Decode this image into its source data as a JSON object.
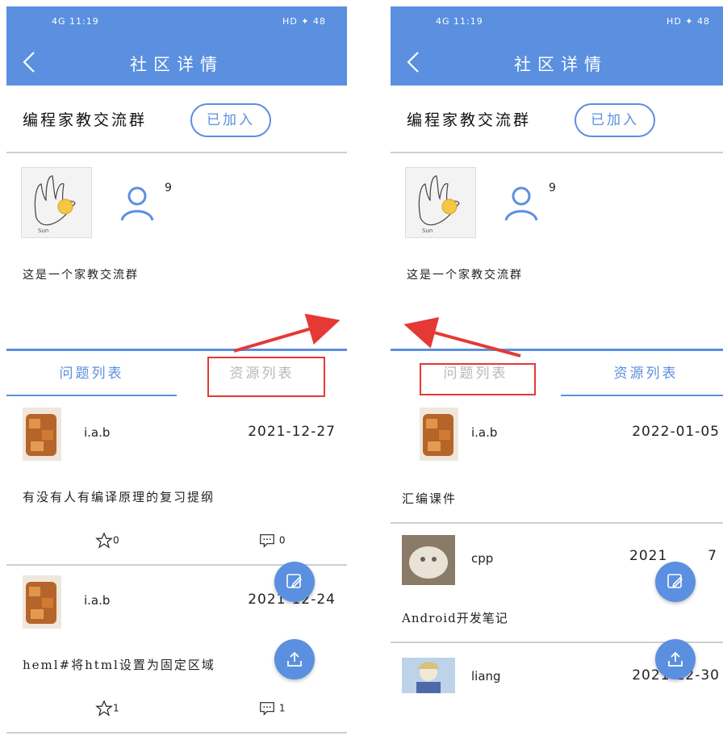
{
  "left": {
    "status": {
      "left": "4G 11:19",
      "right": "HD ✦ 48"
    },
    "nav": {
      "title": "社区详情"
    },
    "group": {
      "name": "编程家教交流群",
      "join_label": "已加入"
    },
    "members": {
      "count": "9"
    },
    "description": "这是一个家教交流群",
    "tabs": [
      {
        "label": "问题列表"
      },
      {
        "label": "资源列表"
      }
    ],
    "posts": [
      {
        "author": "i.a.b",
        "date": "2021-12-27",
        "text": "有没有人有编译原理的复习提纲",
        "stars": "0",
        "comments": "0"
      },
      {
        "author": "i.a.b",
        "date": "2021-12-24",
        "text": "heml#将html设置为固定区域",
        "stars": "1",
        "comments": "1"
      }
    ]
  },
  "right": {
    "status": {
      "left": "4G 11:19",
      "right": "HD ✦ 48"
    },
    "nav": {
      "title": "社区详情"
    },
    "group": {
      "name": "编程家教交流群",
      "join_label": "已加入"
    },
    "members": {
      "count": "9"
    },
    "description": "这是一个家教交流群",
    "tabs": [
      {
        "label": "问题列表"
      },
      {
        "label": "资源列表"
      }
    ],
    "resources": [
      {
        "author": "i.a.b",
        "date": "2022-01-05",
        "text": "汇编课件"
      },
      {
        "author": "cpp",
        "date": "2021",
        "date_tail": "7",
        "text": "Android开发笔记"
      },
      {
        "author": "liang",
        "date": "2021-12-30",
        "text": ""
      }
    ]
  },
  "colors": {
    "accent": "#5b8fe0",
    "highlight": "#e53935"
  }
}
